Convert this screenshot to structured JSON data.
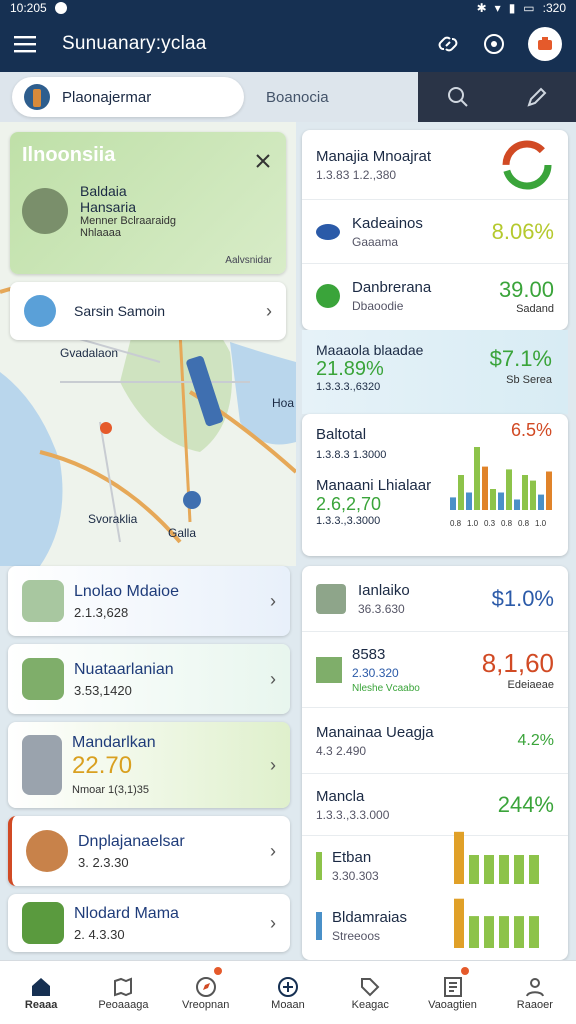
{
  "status": {
    "time": "10:205",
    "battery": ":320"
  },
  "appbar": {
    "title": "Sunuanary:yclaa",
    "menu_icon": "menu-icon",
    "link_icon": "link-icon",
    "help_icon": "help-icon",
    "profile_icon": "profile-icon"
  },
  "tabs": {
    "active": "Plaonajermar",
    "secondary": "Boanocia"
  },
  "map": {
    "region_card": {
      "title": "Ilnoonsiia",
      "name": "Baldaia",
      "subtitle": "Hansaria",
      "line1": "Menner Bclraaraidg",
      "line2": "Nhlaaaa",
      "corner": "Aalvsnidar"
    },
    "search_card": {
      "label": "Sarsin Samoin"
    },
    "labels": {
      "a": "Gvadalaon",
      "b": "Hoa",
      "c": "Svoraklia",
      "d": "Galla"
    }
  },
  "left_list": [
    {
      "title": "Lnolao Mdaioe",
      "value": "2.1.3,628",
      "big": "",
      "sub": "",
      "color": "#1f3c7a"
    },
    {
      "title": "Nuataarlanian",
      "value": "3.53,1420",
      "big": "",
      "sub": "",
      "color": "#1f3c7a"
    },
    {
      "title": "Mandarlkan",
      "value": "",
      "big": "22.70",
      "sub": "Nmoar 1(3,1)35",
      "color": "#1f3c7a"
    },
    {
      "title": "Dnplajanaelsar",
      "value": "3. 2.3.30",
      "big": "",
      "sub": "",
      "color": "#1f3c7a"
    },
    {
      "title": "Nlodard Mama",
      "value": "2. 4.3.30",
      "big": "",
      "sub": "",
      "color": "#1f3c7a"
    }
  ],
  "right_top": {
    "header": {
      "name": "Manajia Mnoajrat",
      "sub": "1.3.83 1.2.,380"
    },
    "rows": [
      {
        "name": "Kadeainos",
        "sub": "Gaaama",
        "value": "8.06%",
        "small": ""
      },
      {
        "name": "Danbrerana",
        "sub": "Dbaoodie",
        "value": "39.00",
        "small": "Sadand"
      }
    ]
  },
  "right_mid": {
    "name": "Maaaola blaadae",
    "value1": "21.89%",
    "sub": "1.3.3.3.,6320",
    "value2": "$7.1%",
    "small": "Sb Serea"
  },
  "right_chart": {
    "name": "Baltotal",
    "sub": "1.3.8.3 1.3000",
    "name2": "Manaani Lhialaar",
    "value": "2.6,2,70",
    "sub2": "1.3.3.,3.3000",
    "pct": "6.5%",
    "bars": [
      0.18,
      0.5,
      0.25,
      0.9,
      0.62,
      0.3,
      0.25,
      0.58,
      0.15,
      0.5,
      0.42,
      0.22,
      0.55
    ],
    "colors": [
      "#4a90c8",
      "#8dc34a",
      "#4a90c8",
      "#8dc34a",
      "#e0832a",
      "#8dc34a",
      "#4a90c8",
      "#8dc34a",
      "#4a90c8",
      "#8dc34a",
      "#8dc34a",
      "#4a90c8",
      "#e0832a"
    ],
    "xlabels": [
      "0.8",
      "1.0",
      "0.3",
      "0.8",
      "0.8",
      "1.0"
    ]
  },
  "right_bottom": {
    "header": {
      "name": "Ianlaiko",
      "sub": "36.3.630",
      "value": "$1.0%"
    },
    "rows": [
      {
        "name": "8583",
        "sub": "2.30.320",
        "sub2": "Nleshe Vcaabo",
        "value": "8,1,60",
        "small": "Edeiaeae",
        "vcolor": "#d14a24"
      },
      {
        "name": "Manainaa Ueagja",
        "sub": "4.3 2.490",
        "value": "4.2%",
        "small": "",
        "vcolor": "#3aa43a"
      },
      {
        "name": "Mancla",
        "sub": "1.3.3.,3.3.000",
        "value": "244%",
        "small": "",
        "vcolor": "#3aa43a"
      },
      {
        "name": "Etban",
        "sub": "3.30.303",
        "value": "",
        "small": "",
        "vcolor": "#3aa43a"
      },
      {
        "name": "Bldamraias",
        "sub": "Streeoos",
        "value": "",
        "small": "",
        "vcolor": "#3aa43a"
      }
    ],
    "bars": [
      0.9,
      0.5,
      0.5,
      0.5,
      0.5,
      0.5,
      0.85,
      0.55,
      0.55,
      0.55,
      0.55,
      0.55
    ]
  },
  "nav": [
    {
      "label": "Reaaa",
      "icon": "home-icon",
      "active": true,
      "badge": false
    },
    {
      "label": "Peoaaaga",
      "icon": "map-icon",
      "active": false,
      "badge": false
    },
    {
      "label": "Vreopnan",
      "icon": "compass-icon",
      "active": false,
      "badge": true
    },
    {
      "label": "Moaan",
      "icon": "add-icon",
      "active": false,
      "badge": false
    },
    {
      "label": "Keagac",
      "icon": "tag-icon",
      "active": false,
      "badge": false
    },
    {
      "label": "Vaoagtien",
      "icon": "list-icon",
      "active": false,
      "badge": true
    },
    {
      "label": "Raaoer",
      "icon": "person-icon",
      "active": false,
      "badge": false
    }
  ]
}
